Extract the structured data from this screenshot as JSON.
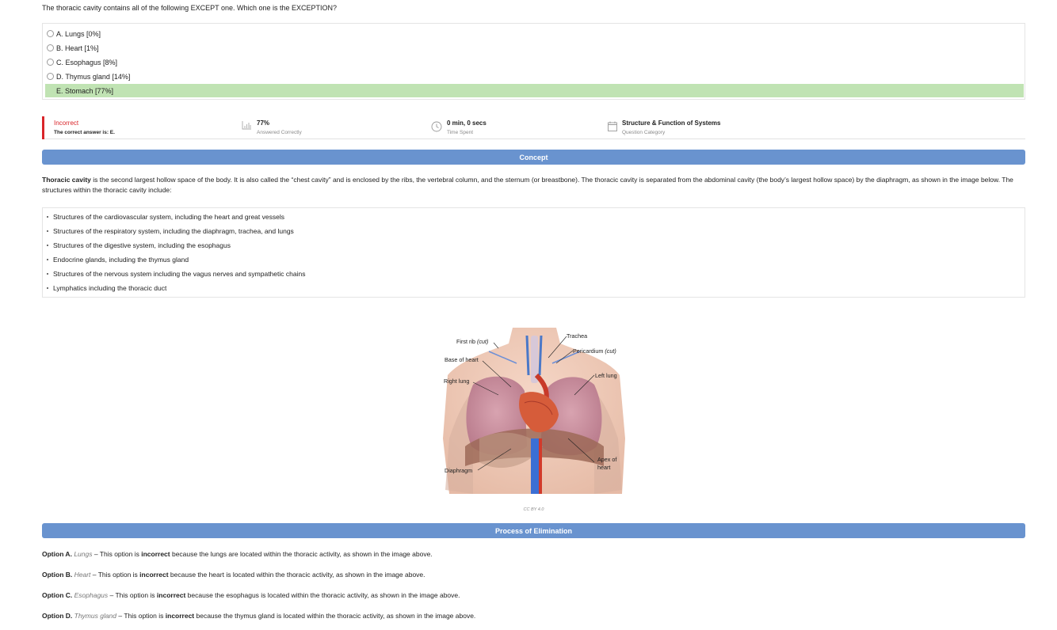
{
  "question": "The thoracic cavity contains all of the following EXCEPT one. Which one is the EXCEPTION?",
  "options": [
    {
      "label": "A. Lungs [0%]",
      "correct": false
    },
    {
      "label": "B. Heart [1%]",
      "correct": false
    },
    {
      "label": "C. Esophagus [8%]",
      "correct": false
    },
    {
      "label": "D. Thymus gland [14%]",
      "correct": false
    },
    {
      "label": "E. Stomach [77%]",
      "correct": true
    }
  ],
  "result": {
    "status": "Incorrect",
    "correct_answer": "The correct answer is: E.",
    "percent": "77%",
    "percent_label": "Answered Correctly",
    "time": "0 min, 0 secs",
    "time_label": "Time Spent",
    "category": "Structure & Function of Systems",
    "category_label": "Question Category",
    "accent_color": "#d9252a"
  },
  "concept": {
    "heading": "Concept",
    "term": "Thoracic cavity",
    "text": " is the second largest hollow space of the body. It is also called the “chest cavity” and is enclosed by the ribs, the vertebral column, and the sternum (or breastbone). The thoracic cavity is separated from the abdominal cavity (the body’s largest hollow space) by the diaphragm, as shown in the image below. The structures within the thoracic cavity include:",
    "structures": [
      "Structures of the cardiovascular system, including the heart and great vessels",
      "Structures of the respiratory system, including the diaphragm, trachea, and lungs",
      "Structures of the digestive system, including the esophagus",
      "Endocrine glands, including the thymus gland",
      "Structures of the nervous system including the vagus nerves and sympathetic chains",
      "Lymphatics including the thoracic duct"
    ]
  },
  "figure": {
    "labels": {
      "first_rib": "First rib",
      "cut": "(cut)",
      "trachea": "Trachea",
      "pericardium": "Pericardium",
      "base_of_heart": "Base of heart",
      "right_lung": "Right lung",
      "left_lung": "Left lung",
      "apex_1": "Apex of",
      "apex_2": "heart",
      "diaphragm": "Diaphragm"
    },
    "credit": "CC BY 4.0"
  },
  "elimination": {
    "heading": "Process of Elimination",
    "items": [
      {
        "option": "Option A.",
        "name": "Lungs",
        "pre": " – This option is ",
        "verdict": "incorrect",
        "post": " because the lungs are located within the thoracic activity, as shown in the image above."
      },
      {
        "option": "Option B.",
        "name": "Heart",
        "pre": " – This option is ",
        "verdict": "incorrect",
        "post": " because the heart is located within the thoracic activity, as shown in the image above."
      },
      {
        "option": "Option C.",
        "name": "Esophagus",
        "pre": " – This option is ",
        "verdict": "incorrect",
        "post": " because the esophagus is located within the thoracic activity, as shown in the image above."
      },
      {
        "option": "Option D.",
        "name": "Thymus gland",
        "pre": " – This option is ",
        "verdict": "incorrect",
        "post": " because the thymus gland is located within the thoracic activity, as shown in the image above."
      }
    ]
  },
  "icons": {
    "percent": "bar-chart-icon",
    "time": "clock-icon",
    "category": "calendar-icon"
  },
  "colors": {
    "section_bar": "#6993cf",
    "correct_highlight": "#c0e3b3"
  }
}
